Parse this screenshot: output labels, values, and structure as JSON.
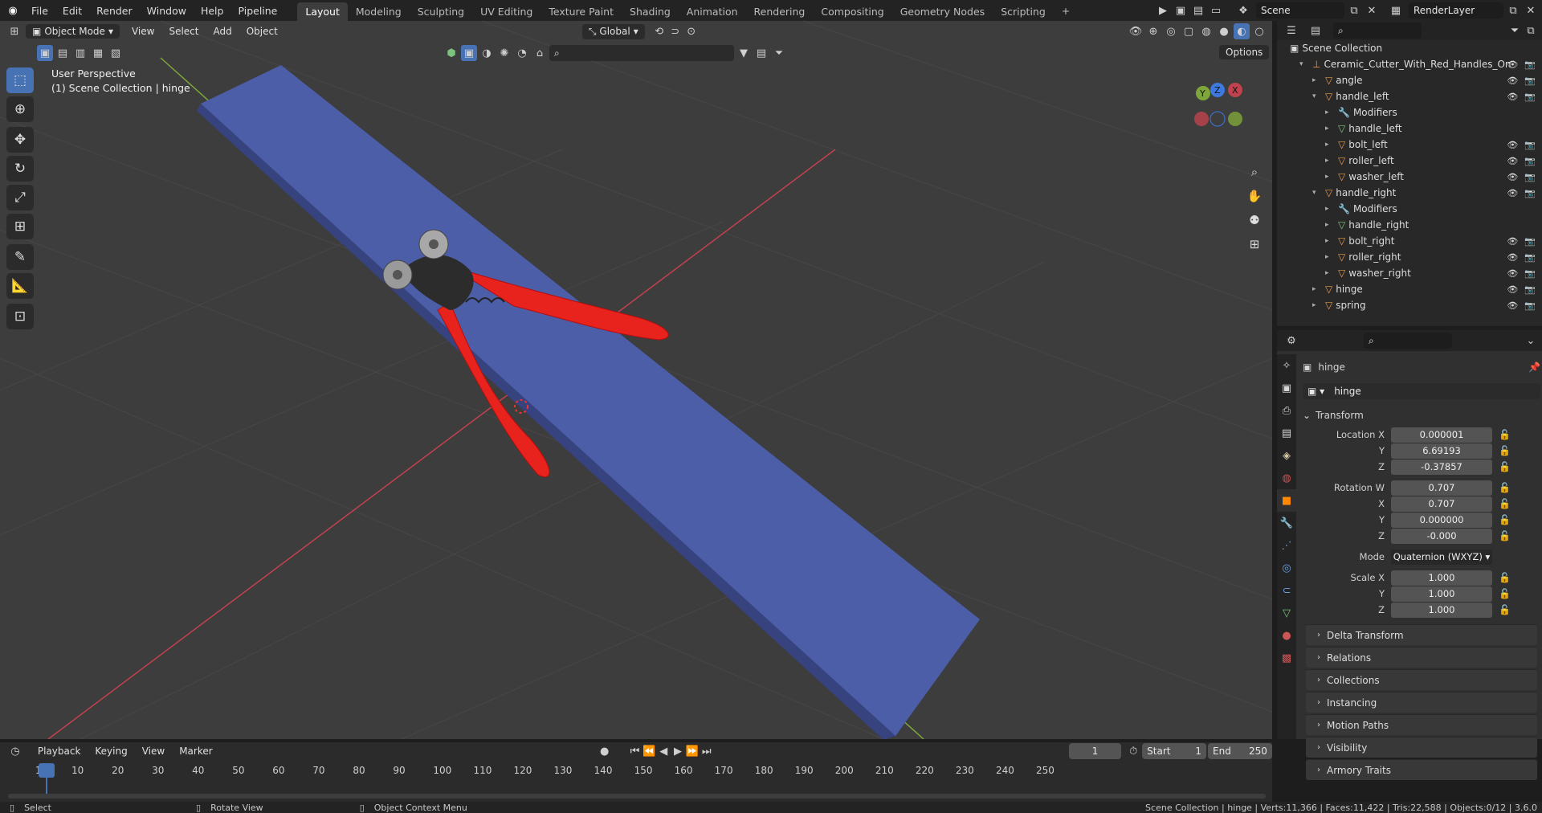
{
  "topbar": {
    "menus": [
      "File",
      "Edit",
      "Render",
      "Window",
      "Help",
      "Pipeline"
    ],
    "workspaces": [
      "Layout",
      "Modeling",
      "Sculpting",
      "UV Editing",
      "Texture Paint",
      "Shading",
      "Animation",
      "Rendering",
      "Compositing",
      "Geometry Nodes",
      "Scripting"
    ],
    "active_workspace": "Layout",
    "add_tab": "+",
    "scene": "Scene",
    "view_layer": "RenderLayer"
  },
  "viewport": {
    "mode": "Object Mode",
    "menus": [
      "View",
      "Select",
      "Add",
      "Object"
    ],
    "orientation": "Global",
    "options": "Options",
    "perspective": "User Perspective",
    "collection_info": "(1) Scene Collection | hinge",
    "gizmo_axes": [
      "X",
      "Y",
      "Z"
    ],
    "colors": {
      "bg": "#3d3d3d",
      "grid": "#454545",
      "x_axis": "#c0424e",
      "y_axis": "#7fa63a",
      "board": "#4c5ea8",
      "handle": "#e8231d"
    }
  },
  "outliner": {
    "root": "Scene Collection",
    "items": [
      {
        "label": "Ceramic_Cutter_With_Red_Handles_On",
        "depth": 0,
        "expanded": true,
        "icon": "object-icon",
        "vis": true
      },
      {
        "label": "angle",
        "depth": 1,
        "expanded": false,
        "icon": "mesh-icon",
        "vis": true
      },
      {
        "label": "handle_left",
        "depth": 1,
        "expanded": true,
        "icon": "mesh-icon",
        "vis": true
      },
      {
        "label": "Modifiers",
        "depth": 2,
        "expanded": false,
        "icon": "wrench-icon",
        "vis": false
      },
      {
        "label": "handle_left",
        "depth": 2,
        "expanded": false,
        "icon": "mesh-data-icon",
        "vis": false
      },
      {
        "label": "bolt_left",
        "depth": 2,
        "expanded": false,
        "icon": "mesh-icon",
        "vis": true
      },
      {
        "label": "roller_left",
        "depth": 2,
        "expanded": false,
        "icon": "mesh-icon",
        "vis": true
      },
      {
        "label": "washer_left",
        "depth": 2,
        "expanded": false,
        "icon": "mesh-icon",
        "vis": true
      },
      {
        "label": "handle_right",
        "depth": 1,
        "expanded": true,
        "icon": "mesh-icon",
        "vis": true
      },
      {
        "label": "Modifiers",
        "depth": 2,
        "expanded": false,
        "icon": "wrench-icon",
        "vis": false
      },
      {
        "label": "handle_right",
        "depth": 2,
        "expanded": false,
        "icon": "mesh-data-icon",
        "vis": false
      },
      {
        "label": "bolt_right",
        "depth": 2,
        "expanded": false,
        "icon": "mesh-icon",
        "vis": true
      },
      {
        "label": "roller_right",
        "depth": 2,
        "expanded": false,
        "icon": "mesh-icon",
        "vis": true
      },
      {
        "label": "washer_right",
        "depth": 2,
        "expanded": false,
        "icon": "mesh-icon",
        "vis": true
      },
      {
        "label": "hinge",
        "depth": 1,
        "expanded": false,
        "icon": "mesh-icon",
        "vis": true
      },
      {
        "label": "spring",
        "depth": 1,
        "expanded": false,
        "icon": "mesh-icon",
        "vis": true
      }
    ]
  },
  "properties": {
    "object_name": "hinge",
    "data_name": "hinge",
    "transform_label": "Transform",
    "location_label": "Location X",
    "location": [
      "0.000001",
      "6.69193",
      "-0.37857"
    ],
    "rotation_label": "Rotation W",
    "rotation": [
      "0.707",
      "0.707",
      "0.000000",
      "-0.000"
    ],
    "mode_label": "Mode",
    "mode": "Quaternion (WXYZ)",
    "scale_label": "Scale X",
    "scale": [
      "1.000",
      "1.000",
      "1.000"
    ],
    "axis_labels": [
      "Y",
      "Z",
      "X",
      "Y",
      "Z"
    ],
    "panels": [
      "Delta Transform",
      "Relations",
      "Collections",
      "Instancing",
      "Motion Paths",
      "Visibility",
      "Armory Traits"
    ]
  },
  "timeline": {
    "menus": [
      "Playback",
      "Keying",
      "View",
      "Marker"
    ],
    "current_frame": "1",
    "start_label": "Start",
    "start": "1",
    "end_label": "End",
    "end": "250",
    "ticks": [
      "1",
      "10",
      "20",
      "30",
      "40",
      "50",
      "60",
      "70",
      "80",
      "90",
      "100",
      "110",
      "120",
      "130",
      "140",
      "150",
      "160",
      "170",
      "180",
      "190",
      "200",
      "210",
      "220",
      "230",
      "240",
      "250"
    ]
  },
  "statusbar": {
    "select": "Select",
    "rotate": "Rotate View",
    "context": "Object Context Menu",
    "stats": "Scene Collection | hinge | Verts:11,366 | Faces:11,422 | Tris:22,588 | Objects:0/12 | 3.6.0"
  }
}
